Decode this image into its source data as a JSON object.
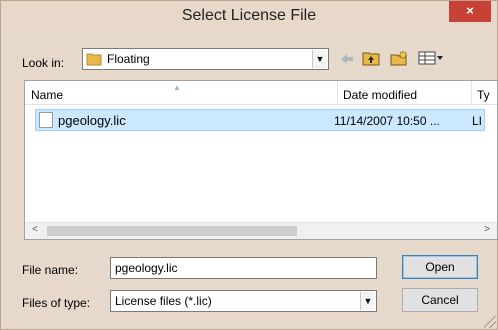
{
  "window": {
    "title": "Select License File",
    "close_glyph": "×"
  },
  "toolbar": {
    "look_in_label": "Look in:",
    "look_in_value": "Floating",
    "icons": [
      "back-arrow-icon",
      "up-folder-icon",
      "new-folder-icon",
      "view-menu-icon"
    ]
  },
  "file_list": {
    "columns": [
      "Name",
      "Date modified",
      "Ty"
    ],
    "rows": [
      {
        "name": "pgeology.lic",
        "date": "11/14/2007 10:50 ...",
        "type": "LI"
      }
    ]
  },
  "form": {
    "file_name_label": "File name:",
    "file_name_value": "pgeology.lic",
    "file_type_label": "Files of type:",
    "file_type_value": "License files (*.lic)"
  },
  "buttons": {
    "open": "Open",
    "cancel": "Cancel"
  }
}
